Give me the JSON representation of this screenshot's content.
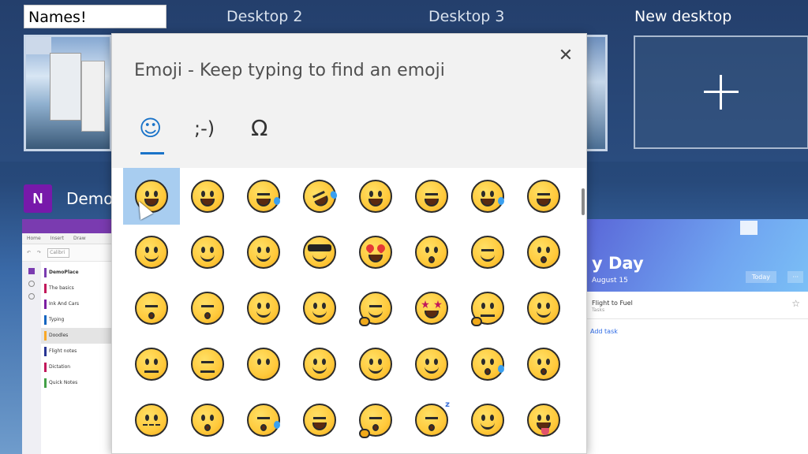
{
  "timeline": {
    "desktops": [
      {
        "name": "Names!",
        "editing": true
      },
      {
        "name": "Desktop 2"
      },
      {
        "name": "Desktop 3"
      },
      {
        "name": "New desktop"
      }
    ]
  },
  "windows": {
    "onenote": {
      "app_title": "Demo",
      "icon_letter": "N",
      "ribbon_tabs": [
        "Home",
        "Insert",
        "Draw"
      ],
      "toolbar_box": "Calibri",
      "notebook": "DemoPlace",
      "sections": [
        {
          "label": "The basics",
          "color": "#c2185b"
        },
        {
          "label": "Ink And Cars",
          "color": "#7b1fa2"
        },
        {
          "label": "Typing",
          "color": "#1565c0"
        },
        {
          "label": "Doodles",
          "color": "#f9a825"
        },
        {
          "label": "Flight notes",
          "color": "#283593"
        },
        {
          "label": "Dictation",
          "color": "#c2185b"
        },
        {
          "label": "Quick Notes",
          "color": "#43a047"
        }
      ]
    },
    "todo": {
      "title": "y Day",
      "date": "August 15",
      "today_btn": "Today",
      "more_btn": "···",
      "task": "Flight to Fuel",
      "task_sub": "Tasks",
      "add_task": "Add task"
    }
  },
  "emoji_panel": {
    "title": "Emoji - Keep typing to find an emoji",
    "close_glyph": "✕",
    "tabs": [
      {
        "name": "emoji",
        "glyph": "☺"
      },
      {
        "name": "kaomoji",
        "glyph": ";-)"
      },
      {
        "name": "symbols",
        "glyph": "Ω"
      }
    ],
    "emojis": [
      [
        "grinning",
        "grin-teeth",
        "joy",
        "rofl",
        "smiley",
        "smile",
        "sweat-smile",
        "laughing"
      ],
      [
        "wink",
        "blush",
        "yum",
        "sunglasses",
        "heart-eyes",
        "kissing-heart",
        "smiling-hearts",
        "kissing"
      ],
      [
        "kissing-smiling",
        "kissing-closed",
        "relaxed",
        "slight-smile",
        "hugging",
        "star-struck",
        "thinking",
        "raised-eyebrow"
      ],
      [
        "neutral",
        "expressionless",
        "no-mouth",
        "eye-roll",
        "smirk",
        "persevere",
        "disappointed-relieved",
        "hushed"
      ],
      [
        "zipper",
        "open-mouth",
        "sleepy",
        "tired",
        "yawning",
        "sleeping",
        "relieved",
        "tongue"
      ]
    ],
    "selected_index": [
      0,
      0
    ],
    "colors": {
      "accent": "#1a73c8",
      "selected_bg": "#a8cdf0",
      "face": "#ffc93b"
    }
  }
}
